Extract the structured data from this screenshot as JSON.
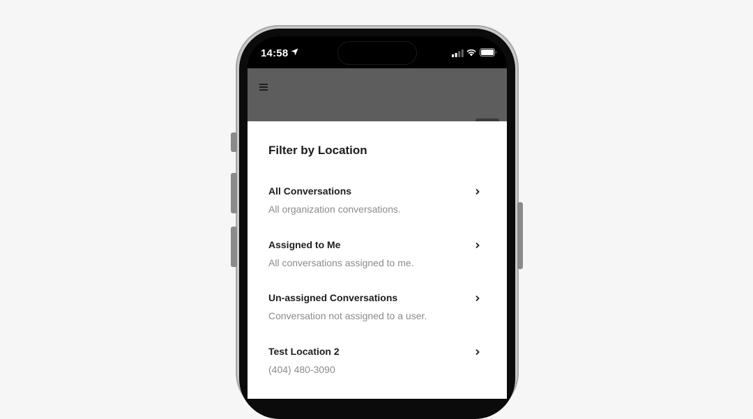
{
  "status_bar": {
    "time": "14:58",
    "location_icon": "location-arrow-icon",
    "signal_icon": "cellular-signal-icon",
    "wifi_icon": "wifi-icon",
    "battery_icon": "battery-icon"
  },
  "header": {
    "menu_icon": "hamburger-menu-icon"
  },
  "sheet": {
    "title": "Filter by Location",
    "items": [
      {
        "title": "All Conversations",
        "subtitle": "All organization conversations."
      },
      {
        "title": "Assigned to Me",
        "subtitle": "All conversations assigned to me."
      },
      {
        "title": "Un-assigned Conversations",
        "subtitle": "Conversation not assigned to a user."
      },
      {
        "title": "Test Location 2",
        "subtitle": "(404) 480-3090"
      }
    ]
  },
  "colors": {
    "page_background": "#f6f6f6",
    "header_overlay": "#5d5d5d",
    "sheet_background": "#ffffff",
    "title_text": "#1b1b1b",
    "subtitle_text": "#8b8b8b"
  }
}
